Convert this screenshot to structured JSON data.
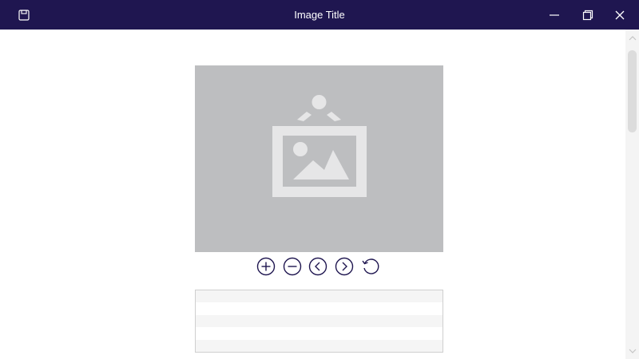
{
  "window": {
    "title": "Image Title",
    "accent_color": "#1f1650"
  },
  "titlebar": {
    "save_icon": "save-icon",
    "minimize_icon": "minimize-icon",
    "maximize_icon": "restore-icon",
    "close_icon": "close-icon"
  },
  "viewer": {
    "placeholder_icon": "image-placeholder-icon",
    "placeholder_color": "#bdbec0",
    "controls": [
      {
        "name": "zoom-in",
        "icon": "plus-circle-icon"
      },
      {
        "name": "zoom-out",
        "icon": "minus-circle-icon"
      },
      {
        "name": "previous",
        "icon": "chevron-left-circle-icon"
      },
      {
        "name": "next",
        "icon": "chevron-right-circle-icon"
      },
      {
        "name": "rotate",
        "icon": "rotate-icon"
      }
    ]
  },
  "info_table": {
    "rows": [
      "",
      "",
      "",
      "",
      ""
    ]
  }
}
